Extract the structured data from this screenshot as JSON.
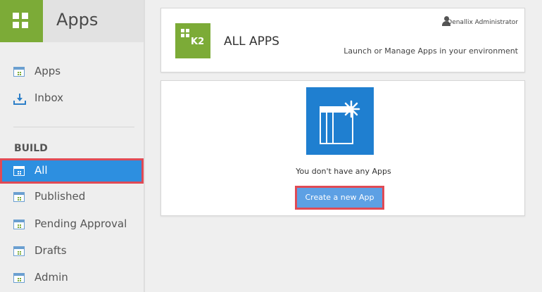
{
  "sidebar": {
    "title": "Apps",
    "nav": [
      {
        "label": "Apps",
        "icon": "apps-icon"
      },
      {
        "label": "Inbox",
        "icon": "inbox-icon"
      }
    ],
    "section_label": "BUILD",
    "build_items": [
      {
        "label": "All",
        "icon": "apps-icon",
        "active": true
      },
      {
        "label": "Published",
        "icon": "apps-icon"
      },
      {
        "label": "Pending Approval",
        "icon": "apps-icon"
      },
      {
        "label": "Drafts",
        "icon": "apps-icon"
      },
      {
        "label": "Admin",
        "icon": "apps-icon"
      }
    ]
  },
  "header": {
    "logo_text": "K2",
    "title": "ALL APPS",
    "user_name": "Denallix Administrator",
    "subtitle": "Launch or Manage Apps in your environment"
  },
  "content": {
    "empty_message": "You don't have any Apps",
    "create_button_label": "Create a new App"
  },
  "colors": {
    "brand_green": "#7cab37",
    "active_blue": "#2d8fe0",
    "button_blue": "#5da0e4",
    "highlight_red": "#e04a55"
  }
}
